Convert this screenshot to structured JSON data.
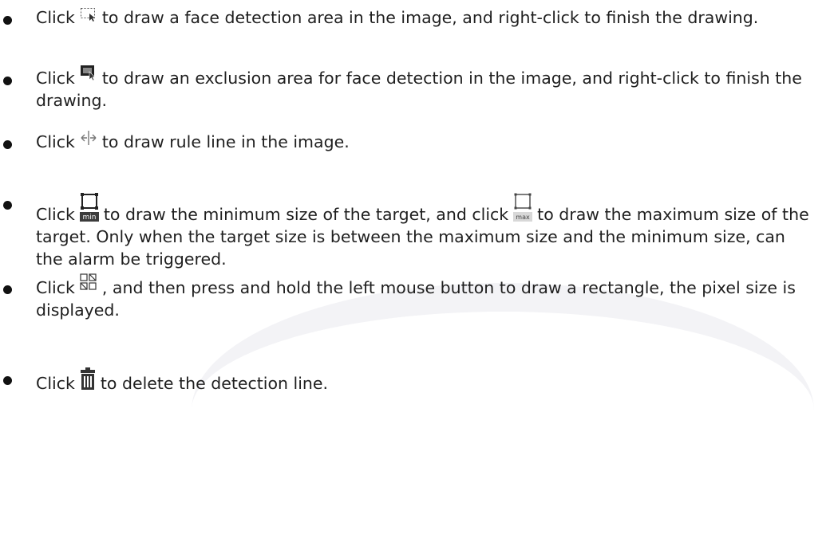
{
  "items": [
    {
      "icon": "face-area-draw-icon",
      "before": "Click",
      "after": "to draw a face detection area in the image, and right-click to finish the drawing."
    },
    {
      "icon": "exclusion-area-draw-icon",
      "before": "Click",
      "after": "to draw an exclusion area for face detection in the image, and right-click to finish the drawing."
    },
    {
      "icon": "rule-line-icon",
      "before": "Click",
      "after": "to draw rule line in the image."
    },
    {
      "icon": "min-size-icon",
      "icon2": "max-size-icon",
      "before": "Click",
      "middle": "to draw the minimum size of the target, and click",
      "after": "to draw the maximum size of the target. Only when the target size is between the maximum size and the minimum size, can the alarm be triggered.",
      "icon_label_min": "min",
      "icon_label_max": "max"
    },
    {
      "icon": "pixel-counter-icon",
      "before": "Click",
      "after": ", and then press and hold the left mouse button to draw a rectangle, the pixel size is displayed."
    },
    {
      "icon": "delete-trash-icon",
      "before": "Click",
      "after": "to delete the detection line."
    }
  ]
}
